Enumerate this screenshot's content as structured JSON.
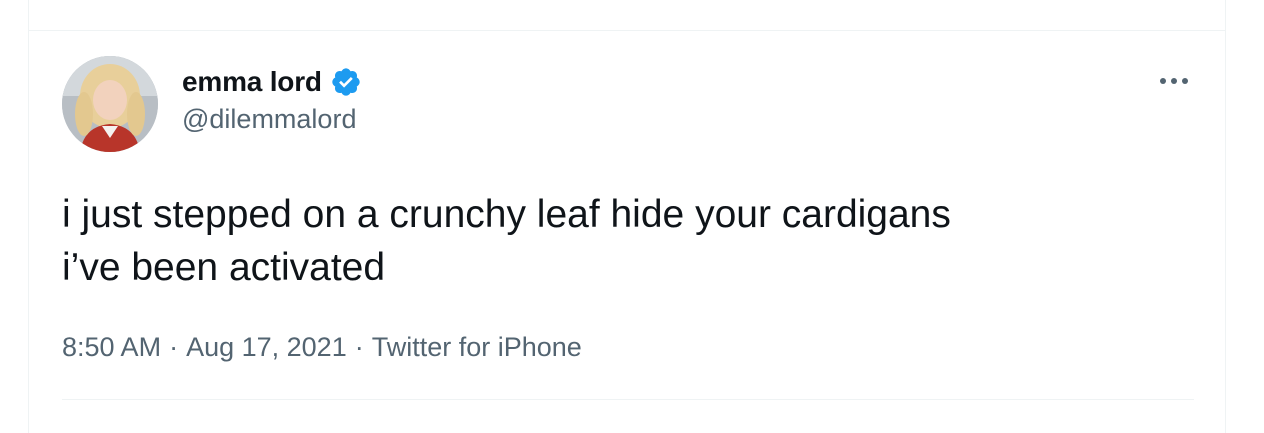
{
  "tweet": {
    "author": {
      "display_name": "emma lord",
      "handle": "@dilemmalord",
      "verified": true,
      "avatar_icon": "profile-photo"
    },
    "text": "i just stepped on a crunchy leaf hide your cardigans\ni’ve been activated",
    "meta": {
      "time": "8:50 AM",
      "separator": "·",
      "date": "Aug 17, 2021",
      "source": "Twitter for iPhone"
    },
    "more_icon": "more-horizontal-icon"
  },
  "colors": {
    "text_primary": "#0f1419",
    "text_secondary": "#536471",
    "verified_blue": "#1d9bf0",
    "divider": "#eff3f4"
  }
}
